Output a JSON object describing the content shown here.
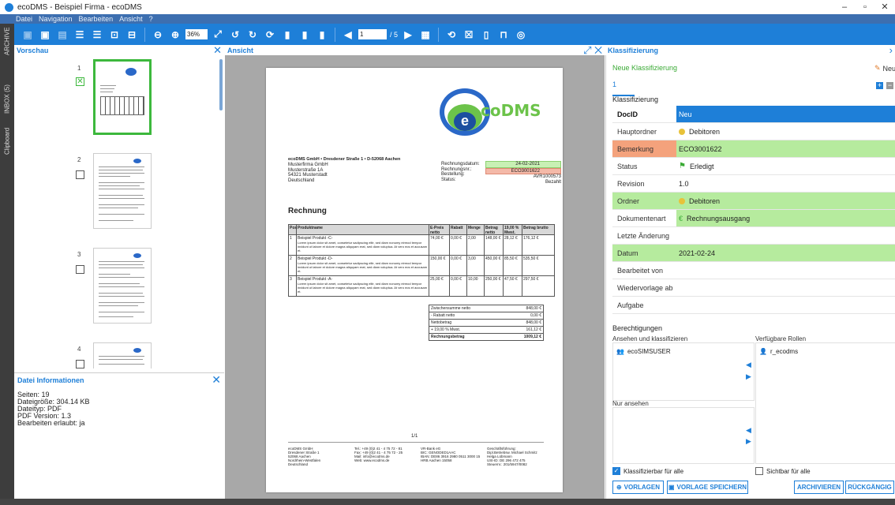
{
  "window": {
    "title": "ecoDMS - Beispiel Firma - ecoDMS",
    "minimize": "–",
    "maximize": "▫",
    "close": "✕"
  },
  "menu": [
    "Datei",
    "Navigation",
    "Bearbeiten",
    "Ansicht",
    "?"
  ],
  "leftstrip": {
    "archive": "ARCHIVE",
    "inbox": "INBOX (5)",
    "clipboard": "Clipboard"
  },
  "toolbar": {
    "zoom": "36%",
    "page": "1",
    "total": "/ 5"
  },
  "panels": {
    "preview": "Vorschau",
    "view": "Ansicht",
    "classify": "Klassifizierung"
  },
  "preview": {
    "pages": [
      "1",
      "2",
      "3",
      "4"
    ]
  },
  "fileinfo": {
    "title": "Datei Informationen",
    "lines": [
      "Seiten: 19",
      "Dateigröße: 304.14 KB",
      "Dateityp: PDF",
      "PDF Version: 1.3",
      "Bearbeiten erlaubt: ja"
    ]
  },
  "document": {
    "sender": "ecoDMS GmbH • Dresdener Straße 1 • D-52068 Aachen",
    "address": [
      "Musterfirma GmbH",
      "Musterstraße 1A",
      "54321 Musterstadt",
      "Deutschland"
    ],
    "meta_labels": [
      "Rechnungsdatum:",
      "Rechnungsnr.:",
      "Bestellung:",
      "Status:"
    ],
    "meta_values": [
      "24-02-2021",
      "ECO3001622",
      "AVR1000573",
      "Bezahlt"
    ],
    "heading": "Rechnung",
    "table_headers": [
      "Pos",
      "Produktname",
      "E-Preis netto",
      "Rabatt",
      "Menge",
      "Betrag netto",
      "19,00 % Mwst.",
      "Betrag brutto"
    ],
    "rows": [
      {
        "pos": "1",
        "name": "Beispiel Produkt -C-",
        "e": "74,00 €",
        "r": "0,00 €",
        "m": "2,00",
        "b": "148,00 €",
        "mw": "28,12 €",
        "br": "176,12 €"
      },
      {
        "pos": "2",
        "name": "Beispiel Produkt -D-",
        "e": "150,00 €",
        "r": "0,00 €",
        "m": "3,00",
        "b": "450,00 €",
        "mw": "85,50 €",
        "br": "535,50 €"
      },
      {
        "pos": "3",
        "name": "Beispiel Produkt -A-",
        "e": "25,00 €",
        "r": "0,00 €",
        "m": "10,00",
        "b": "250,00 €",
        "mw": "47,50 €",
        "br": "297,50 €"
      }
    ],
    "row_text": "Lorem ipsum dolor sit amet, consetetur sadipscing elitr, sed diam nonumy eirmod tempor invidunt ut labore et dolore magna aliquyam erat, sed diam voluptua. At vero eos et accusam et.",
    "totals": [
      {
        "l": "Zwischensumme netto",
        "v": "848,00 €"
      },
      {
        "l": "- Rabatt netto",
        "v": "0,00 €"
      },
      {
        "l": "Nettobetrag",
        "v": "848,00 €"
      },
      {
        "l": "+ 19,00 % Mwst.",
        "v": "161,12 €"
      },
      {
        "l": "Rechnungsbetrag",
        "v": "1009,12 €"
      }
    ],
    "pagenum": "1/1",
    "footer": [
      "ecoDMS GmbH\nDresdener Straße 1\n52068 Aachen\nNordrhein-Westfalen\nDeutschland",
      "Tel.: +49 (0)2 41 - 4 75 72 - 81\nFax: +49 (0)2 41 - 4 75 72 - 25\nMail: info@ecodms.de\nWeb: www.ecodms.de",
      "VR-Bank eG\nBIC: GENODED1AAC\nIBAN: DE86 3916 2980 0511 3000 15\nHRB Aachen 15058",
      "Geschäftsführung:\nDipl.Betriebsw. Michael Schmitz\nHelga Lübmann\nUSt-ID: DE 296 472 475\nSteuernr.: 201/5947/0082"
    ],
    "logo_left": "e",
    "logo_right": "coDMS"
  },
  "classify": {
    "new": "Neue Klassifizierung",
    "new_btn": "Neu",
    "tab": "1",
    "section": "Klassifizierung",
    "fields": [
      {
        "l": "DocID",
        "v": "Neu"
      },
      {
        "l": "Hauptordner",
        "v": "Debitoren"
      },
      {
        "l": "Bemerkung",
        "v": "ECO3001622"
      },
      {
        "l": "Status",
        "v": "Erledigt"
      },
      {
        "l": "Revision",
        "v": "1.0"
      },
      {
        "l": "Ordner",
        "v": "Debitoren"
      },
      {
        "l": "Dokumentenart",
        "v": "Rechnungsausgang"
      },
      {
        "l": "Letzte Änderung",
        "v": ""
      },
      {
        "l": "Datum",
        "v": "2021-02-24"
      },
      {
        "l": "Bearbeitet von",
        "v": ""
      },
      {
        "l": "Wiedervorlage ab",
        "v": ""
      },
      {
        "l": "Aufgabe",
        "v": ""
      }
    ],
    "perms": "Berechtigungen",
    "view_classify": "Ansehen und klassifizieren",
    "roles": "Verfügbare Rollen",
    "user": "ecoSIMSUSER",
    "role": "r_ecodms",
    "view_only": "Nur ansehen",
    "chk1": "Klassifizierbar für alle",
    "chk2": "Sichtbar für alle",
    "btn_templates": "VORLAGEN",
    "btn_save": "VORLAGE SPEICHERN",
    "btn_archive": "ARCHIVIEREN",
    "btn_back": "RÜCKGÄNGIG"
  }
}
